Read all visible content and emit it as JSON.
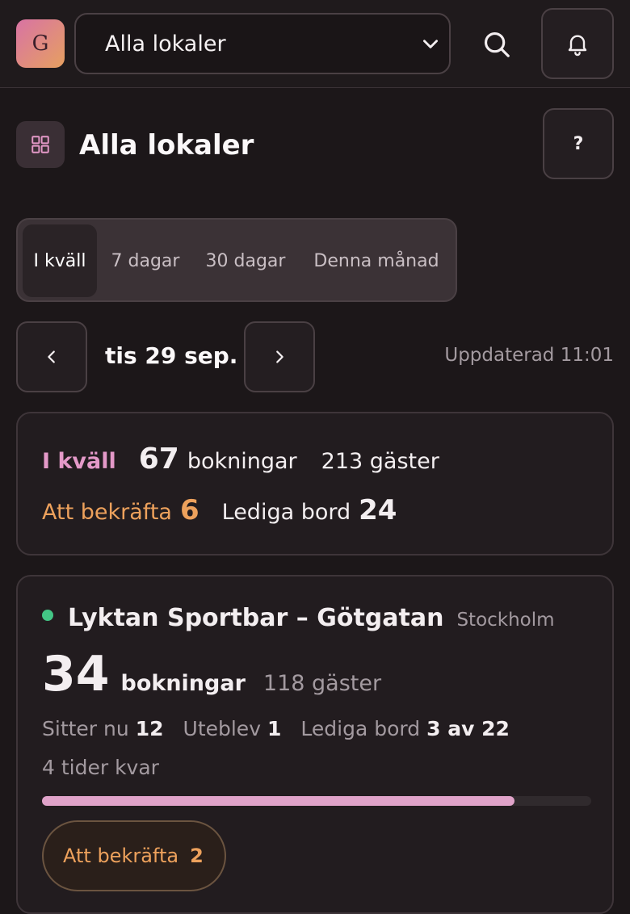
{
  "header": {
    "logo_letter": "G",
    "venue_select": {
      "value": "Alla lokaler"
    },
    "icons": {
      "search": "search-icon",
      "bell": "bell-icon"
    }
  },
  "page": {
    "title": "Alla lokaler",
    "help_label": "?"
  },
  "tabs": [
    {
      "label": "I kväll",
      "active": true
    },
    {
      "label": "7 dagar",
      "active": false
    },
    {
      "label": "30 dagar",
      "active": false
    },
    {
      "label": "Denna månad",
      "active": false
    }
  ],
  "date_nav": {
    "date": "tis 29 sep.",
    "updated": "Uppdaterad 11:01"
  },
  "summary": {
    "period": "I kväll",
    "bookings_count": "67",
    "bookings_label": "bokningar",
    "guests": "213 gäster",
    "to_confirm_label": "Att bekräfta",
    "to_confirm_count": "6",
    "free_tables_label": "Lediga bord",
    "free_tables_count": "24"
  },
  "venue": {
    "name": "Lyktan Sportbar – Götgatan",
    "city": "Stockholm",
    "status_color": "#43c585",
    "bookings_count": "34",
    "bookings_label": "bokningar",
    "guests": "118 gäster",
    "seated_label": "Sitter nu",
    "seated_count": "12",
    "noshow_label": "Uteblev",
    "noshow_count": "1",
    "free_tables_label": "Lediga bord",
    "free_tables_value": "3 av 22",
    "times_left": "4 tider kvar",
    "progress": 0.86,
    "confirm_button_label": "Att bekräfta",
    "confirm_button_count": "2"
  },
  "colors": {
    "accent_pink": "#e499c8",
    "accent_orange": "#eda15c",
    "background": "#1c1719"
  }
}
